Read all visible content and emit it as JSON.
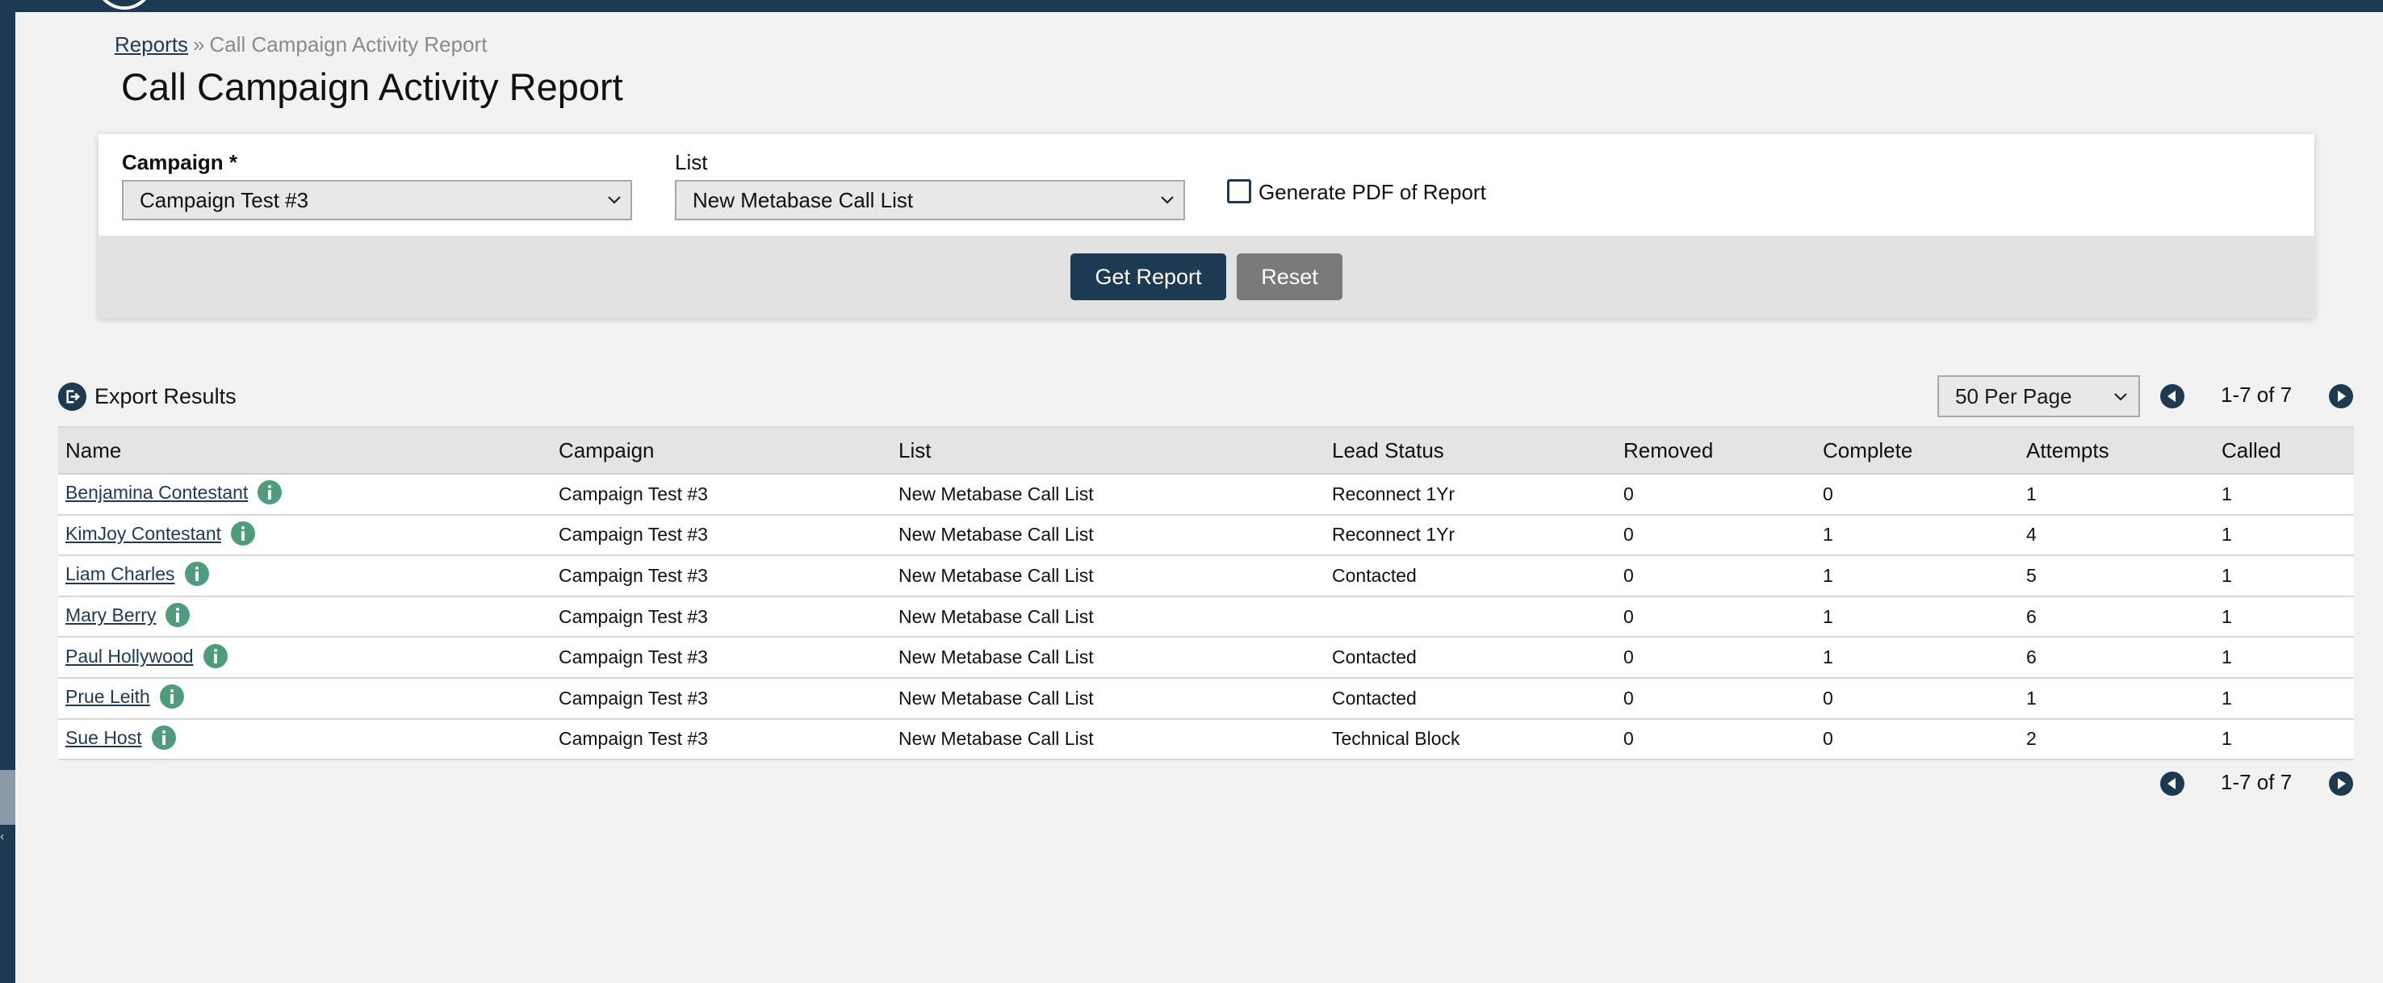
{
  "breadcrumb": {
    "parent": "Reports",
    "separator": "»",
    "current": "Call Campaign Activity Report"
  },
  "page_title": "Call Campaign Activity Report",
  "filters": {
    "campaign_label": "Campaign *",
    "campaign_value": "Campaign Test #3",
    "list_label": "List",
    "list_value": "New Metabase Call List",
    "pdf_checkbox_label": "Generate PDF of Report",
    "pdf_checked": false,
    "get_report_label": "Get Report",
    "reset_label": "Reset"
  },
  "export_label": "Export Results",
  "pagination": {
    "per_page": "50 Per Page",
    "range": "1-7 of 7"
  },
  "table": {
    "columns": [
      "Name",
      "Campaign",
      "List",
      "Lead Status",
      "Removed",
      "Complete",
      "Attempts",
      "Called"
    ],
    "rows": [
      {
        "name": "Benjamina Contestant",
        "campaign": "Campaign Test #3",
        "list": "New Metabase Call List",
        "lead_status": "Reconnect 1Yr",
        "removed": "0",
        "complete": "0",
        "attempts": "1",
        "called": "1"
      },
      {
        "name": "KimJoy Contestant",
        "campaign": "Campaign Test #3",
        "list": "New Metabase Call List",
        "lead_status": "Reconnect 1Yr",
        "removed": "0",
        "complete": "1",
        "attempts": "4",
        "called": "1"
      },
      {
        "name": "Liam Charles",
        "campaign": "Campaign Test #3",
        "list": "New Metabase Call List",
        "lead_status": "Contacted",
        "removed": "0",
        "complete": "1",
        "attempts": "5",
        "called": "1"
      },
      {
        "name": "Mary Berry",
        "campaign": "Campaign Test #3",
        "list": "New Metabase Call List",
        "lead_status": "",
        "removed": "0",
        "complete": "1",
        "attempts": "6",
        "called": "1"
      },
      {
        "name": "Paul Hollywood",
        "campaign": "Campaign Test #3",
        "list": "New Metabase Call List",
        "lead_status": "Contacted",
        "removed": "0",
        "complete": "1",
        "attempts": "6",
        "called": "1"
      },
      {
        "name": "Prue Leith",
        "campaign": "Campaign Test #3",
        "list": "New Metabase Call List",
        "lead_status": "Contacted",
        "removed": "0",
        "complete": "0",
        "attempts": "1",
        "called": "1"
      },
      {
        "name": "Sue Host",
        "campaign": "Campaign Test #3",
        "list": "New Metabase Call List",
        "lead_status": "Technical Block",
        "removed": "0",
        "complete": "0",
        "attempts": "2",
        "called": "1"
      }
    ]
  },
  "colors": {
    "brand": "#1e3a52",
    "info_icon": "#4f9c7d",
    "reset_button": "#7a7a7a",
    "background": "#f2f2f2"
  },
  "icons": {
    "export": "export-circle-icon",
    "info": "info-icon",
    "prev": "chevron-left-circle-icon",
    "next": "chevron-right-circle-icon",
    "dropdown": "chevron-down-icon"
  }
}
